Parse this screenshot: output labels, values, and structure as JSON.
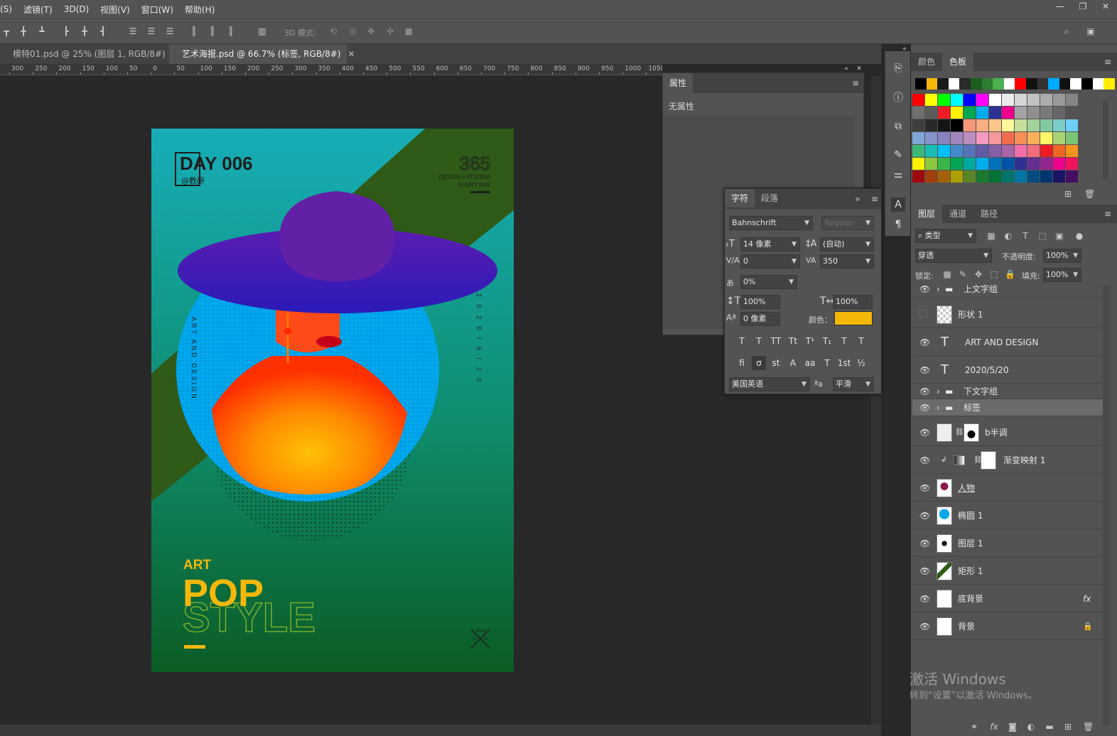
{
  "menu": [
    "选择(S)",
    "滤镜(T)",
    "3D(D)",
    "视图(V)",
    "窗口(W)",
    "帮助(H)"
  ],
  "menu_first_visible": "(S)",
  "options_bar": {
    "mode3d_label": "3D 模式:"
  },
  "tabs": [
    {
      "label": "模特01.psd @ 25% (图层 1, RGB/8#)",
      "active": false
    },
    {
      "label": "艺术海报.psd @ 66.7% (标签, RGB/8#)",
      "active": true
    }
  ],
  "ruler_ticks": [
    "300",
    "250",
    "200",
    "150",
    "100",
    "50",
    "0",
    "50",
    "100",
    "150",
    "200",
    "250",
    "300",
    "350",
    "400",
    "450",
    "500",
    "550",
    "600",
    "650",
    "700",
    "750",
    "800",
    "850",
    "900",
    "950",
    "1000",
    "1050"
  ],
  "poster": {
    "day": "DAY  006",
    "handle": "@教研",
    "num365": "365",
    "tag1": "DESIGN A POSTER",
    "tag2": "EVERY DAY",
    "vertical_left": "ART AND DESIGN",
    "vertical_right": "2 0 2 0 / 5 / 2 0",
    "art": "ART",
    "pop": "POP",
    "style": "STYLE",
    "stamp_year": "2020",
    "stamp_left": "12",
    "stamp_right": "31"
  },
  "properties_panel": {
    "title": "属性",
    "content": "无属性"
  },
  "character_panel": {
    "tab_char": "字符",
    "tab_para": "段落",
    "font_family": "Bahnschrift",
    "font_style": "Regular",
    "font_size": "14 像素",
    "leading": "(自动)",
    "kerning": "0",
    "tracking": "350",
    "scale_tsume": "0%",
    "vertical_scale": "100%",
    "horizontal_scale": "100%",
    "baseline_shift": "0 像素",
    "color_label": "颜色：",
    "color_value": "#f5b80a",
    "language": "美国英语",
    "aa_label": "ªa",
    "antialias": "平滑",
    "format_buttons": [
      "T",
      "T",
      "TT",
      "Tt",
      "T¹",
      "T₁",
      "T",
      "T"
    ],
    "opentype_buttons": [
      "fi",
      "σ",
      "st",
      "A",
      "aa",
      "T",
      "1st",
      "½"
    ]
  },
  "swatch_panel": {
    "tab_color": "颜色",
    "tab_swatch": "色板",
    "top_row": [
      "#000000",
      "#f5b80a",
      "#1a1a1a",
      "#ffffff",
      "#2a2a2a",
      "#1b5e20",
      "#2e7d32",
      "#4caf50",
      "#ffffff",
      "#ff0000",
      "#111111",
      "#333333",
      "#00aaff",
      "#111111",
      "#ffffff",
      "#000000",
      "#ffffff",
      "#ffee00"
    ],
    "grid": [
      [
        "#ff0000",
        "#ffff00",
        "#00ff00",
        "#00ffff",
        "#0000ff",
        "#ff00ff",
        "#ffffff",
        "#ebebeb",
        "#d6d6d6",
        "#c2c2c2",
        "#adadad",
        "#999999",
        "#858585"
      ],
      [
        "#707070",
        "#5c5c5c",
        "#ee1c24",
        "#fff200",
        "#00a650",
        "#00aeef",
        "#2e3192",
        "#ec008c",
        "#a3a3a3",
        "#8f8f8f",
        "#7a7a7a",
        "#666666",
        "#525252"
      ],
      [
        "#3d3d3d",
        "#292929",
        "#141414",
        "#000000",
        "#f7977a",
        "#f9ad81",
        "#fdc68a",
        "#fff79a",
        "#c4df9b",
        "#a3d39c",
        "#82ca9d",
        "#7bcdc8",
        "#6ecff6"
      ],
      [
        "#7ea7d8",
        "#8493ca",
        "#8882be",
        "#a186be",
        "#bc8dbf",
        "#f49ac2",
        "#f6989d",
        "#f26c4f",
        "#f68e56",
        "#fbaf5d",
        "#fff568",
        "#acd373",
        "#7cc576"
      ],
      [
        "#3bb878",
        "#1abbb4",
        "#00bff3",
        "#438ccb",
        "#5674b9",
        "#605ca8",
        "#8560a8",
        "#a864a8",
        "#f06eaa",
        "#f26d7d",
        "#ed1c24",
        "#f26522",
        "#f7941d"
      ],
      [
        "#fff200",
        "#8dc63f",
        "#39b54a",
        "#00a651",
        "#00a99d",
        "#00aeef",
        "#0072bc",
        "#0054a6",
        "#2e3192",
        "#662d91",
        "#92278f",
        "#ec008c",
        "#ed145b"
      ],
      [
        "#9e0b0f",
        "#a0410d",
        "#a36209",
        "#aba000",
        "#598527",
        "#1a7b30",
        "#007236",
        "#00746b",
        "#0076a3",
        "#004b80",
        "#003471",
        "#1b1464",
        "#440e62"
      ]
    ]
  },
  "layers_panel": {
    "tab_layers": "图层",
    "tab_channels": "通道",
    "tab_paths": "路径",
    "filter_kind": "类型",
    "blend_mode": "穿透",
    "opacity_label": "不透明度:",
    "opacity": "100%",
    "lock_label": "锁定:",
    "fill_label": "填充:",
    "fill": "100%",
    "layers": [
      {
        "name": "上文字组",
        "type": "group",
        "visible": true
      },
      {
        "name": "形状 1",
        "type": "shape",
        "visible": false
      },
      {
        "name": "ART  AND  DESIGN",
        "type": "text",
        "visible": true
      },
      {
        "name": "2020/5/20",
        "type": "text",
        "visible": true
      },
      {
        "name": "下文字组",
        "type": "group",
        "visible": true
      },
      {
        "name": "标签",
        "type": "group",
        "visible": true,
        "selected": true
      },
      {
        "name": "b半调",
        "type": "masked",
        "visible": true
      },
      {
        "name": "渐变映射 1",
        "type": "adjustment",
        "visible": true
      },
      {
        "name": "人物",
        "type": "pixel",
        "visible": true
      },
      {
        "name": "椭圆 1",
        "type": "shape",
        "visible": true
      },
      {
        "name": "图层 1",
        "type": "pixel",
        "visible": true
      },
      {
        "name": "矩形 1",
        "type": "shape",
        "visible": true
      },
      {
        "name": "底背景",
        "type": "fx",
        "visible": true
      },
      {
        "name": "背景",
        "type": "locked",
        "visible": true
      }
    ]
  },
  "watermark": {
    "line1": "激活 Windows",
    "line2": "转到“设置”以激活 Windows。"
  },
  "colors": {
    "panel": "#535353",
    "dark": "#424242",
    "canvas": "#282828",
    "accent_yellow": "#f5b80a"
  }
}
